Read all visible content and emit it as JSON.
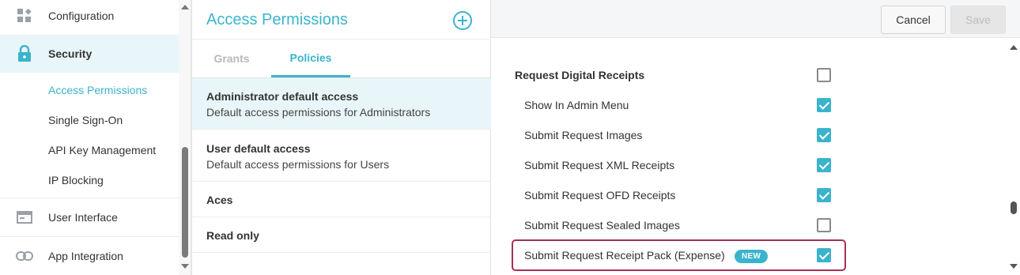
{
  "colors": {
    "accent": "#3ab4cc",
    "highlight": "#a33059",
    "active_bg": "#e9f6f9"
  },
  "sidebar": {
    "items": [
      {
        "label": "Configuration",
        "icon": "grid-config-icon"
      },
      {
        "label": "Security",
        "icon": "lock-icon",
        "active": true,
        "children": [
          {
            "label": "Access Permissions",
            "active": true
          },
          {
            "label": "Single Sign-On"
          },
          {
            "label": "API Key Management"
          },
          {
            "label": "IP Blocking"
          }
        ]
      },
      {
        "label": "User Interface",
        "icon": "window-icon"
      },
      {
        "label": "App Integration",
        "icon": "link-icon"
      }
    ]
  },
  "middle": {
    "title": "Access Permissions",
    "add_icon": "add-circle-icon",
    "tabs": [
      {
        "label": "Grants"
      },
      {
        "label": "Policies",
        "active": true
      }
    ],
    "policies": [
      {
        "name": "Administrator default access",
        "description": "Default access permissions for Administrators",
        "active": true
      },
      {
        "name": "User default access",
        "description": "Default access permissions for Users"
      },
      {
        "name": "Aces",
        "description": ""
      },
      {
        "name": "Read only",
        "description": ""
      }
    ]
  },
  "right": {
    "cancel_label": "Cancel",
    "save_label": "Save",
    "permissions": [
      {
        "label": "Request Digital Receipts",
        "checked": false,
        "group": true
      },
      {
        "label": "Show In Admin Menu",
        "checked": true
      },
      {
        "label": "Submit Request Images",
        "checked": true
      },
      {
        "label": "Submit Request XML Receipts",
        "checked": true
      },
      {
        "label": "Submit Request OFD Receipts",
        "checked": true
      },
      {
        "label": "Submit Request Sealed Images",
        "checked": false
      },
      {
        "label": "Submit Request Receipt Pack (Expense)",
        "checked": true,
        "badge": "NEW"
      }
    ]
  }
}
